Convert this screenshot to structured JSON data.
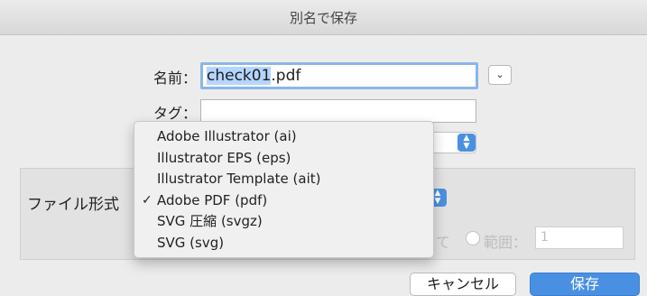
{
  "dialog": {
    "title": "別名で保存"
  },
  "form": {
    "name_label": "名前：",
    "name_selected": "check01",
    "name_rest": ".pdf",
    "tag_label": "タグ：",
    "format_label": "ファイル形式"
  },
  "menu": {
    "selected_index": 3,
    "checkmark": "✓",
    "items": [
      {
        "label": "Adobe Illustrator (ai)"
      },
      {
        "label": "Illustrator EPS (eps)"
      },
      {
        "label": "Illustrator Template (ait)"
      },
      {
        "label": "Adobe PDF (pdf)"
      },
      {
        "label": "SVG 圧縮 (svgz)"
      },
      {
        "label": "SVG (svg)"
      }
    ]
  },
  "range": {
    "partial_label": "て",
    "label": "範囲：",
    "value": "1"
  },
  "buttons": {
    "cancel": "キャンセル",
    "save": "保存"
  },
  "colors": {
    "accent": "#4a90e2",
    "selection": "#b5d5ff"
  }
}
